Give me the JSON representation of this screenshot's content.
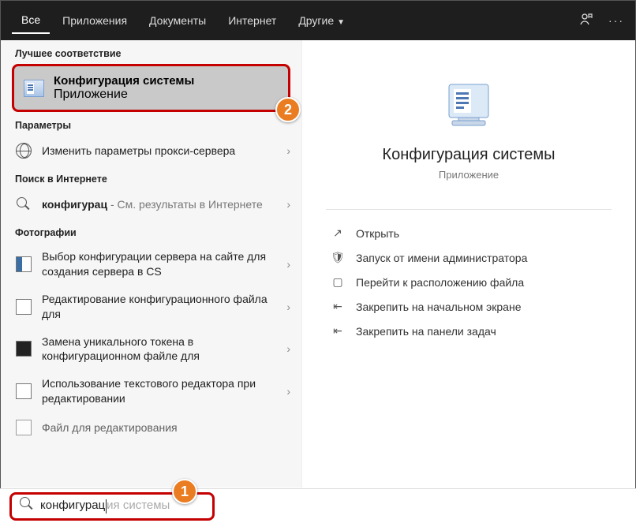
{
  "topbar": {
    "tabs": [
      {
        "label": "Все",
        "active": true
      },
      {
        "label": "Приложения",
        "active": false
      },
      {
        "label": "Документы",
        "active": false
      },
      {
        "label": "Интернет",
        "active": false
      },
      {
        "label": "Другие",
        "active": false,
        "dropdown": true
      }
    ]
  },
  "annotations": {
    "badge1": "1",
    "badge2": "2"
  },
  "left": {
    "best_match_header": "Лучшее соответствие",
    "best_match": {
      "title": "Конфигурация системы",
      "subtitle": "Приложение"
    },
    "settings_header": "Параметры",
    "settings_item": "Изменить параметры прокси-сервера",
    "web_header": "Поиск в Интернете",
    "web_item_prefix": "конфигурац",
    "web_item_suffix": " - См. результаты в Интернете",
    "photos_header": "Фотографии",
    "photos": [
      "Выбор конфигурации сервера на сайте для создания сервера в CS",
      "Редактирование конфигурационного файла для",
      "Замена уникального токена в конфигурационном файле для",
      "Использование текстового редактора при редактировании",
      "Файл для редактирования"
    ]
  },
  "right": {
    "title": "Конфигурация системы",
    "subtitle": "Приложение",
    "actions": [
      "Открыть",
      "Запуск от имени администратора",
      "Перейти к расположению файла",
      "Закрепить на начальном экране",
      "Закрепить на панели задач"
    ]
  },
  "search": {
    "typed": "конфигурац",
    "ghost": "ия системы"
  }
}
